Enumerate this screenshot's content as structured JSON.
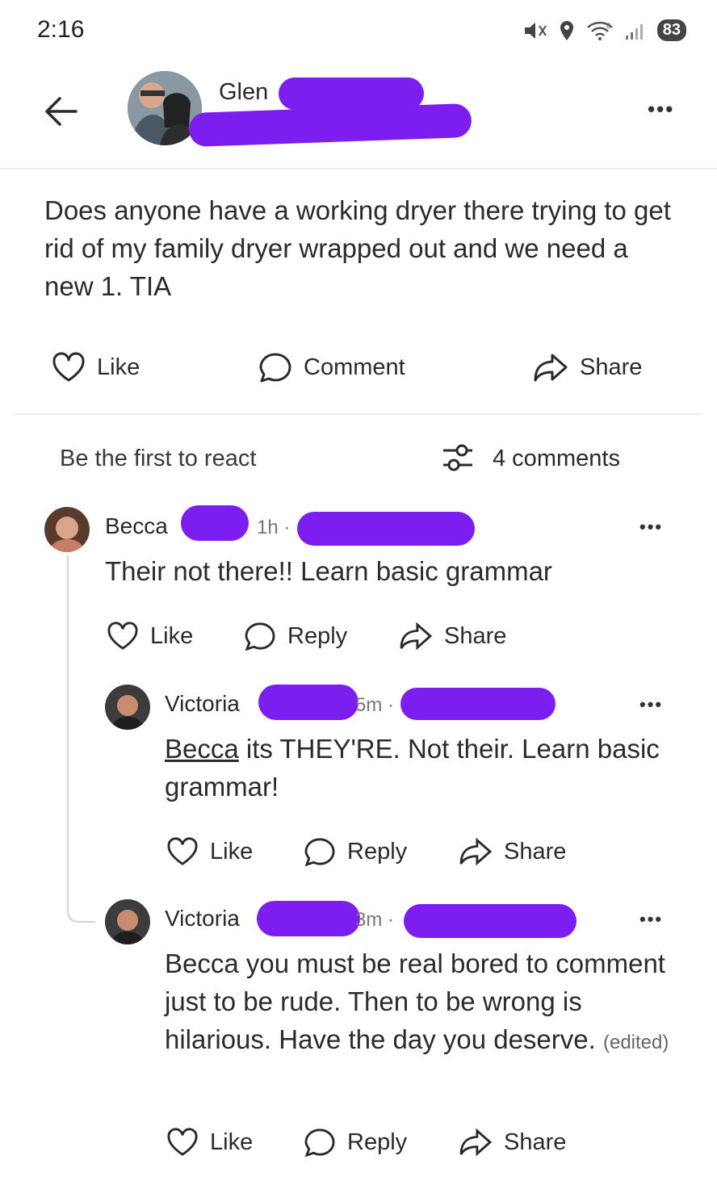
{
  "status_bar": {
    "time": "2:16",
    "battery": "83",
    "network": "6"
  },
  "post": {
    "author_first": "Glen",
    "text": "Does anyone have a working dryer there trying to get rid of my family dryer wrapped out and we need a new 1. TIA",
    "actions": {
      "like": "Like",
      "comment": "Comment",
      "share": "Share"
    },
    "react_prompt": "Be the first to react",
    "comments_count": "4 comments"
  },
  "comments": [
    {
      "name": "Becca",
      "time": "1h ·",
      "text": "Their not there!! Learn basic grammar",
      "actions": {
        "like": "Like",
        "reply": "Reply",
        "share": "Share"
      }
    },
    {
      "name": "Victoria",
      "time": "5m ·",
      "mention": "Becca",
      "text": " its THEY'RE. Not their. Learn basic grammar!",
      "actions": {
        "like": "Like",
        "reply": "Reply",
        "share": "Share"
      }
    },
    {
      "name": "Victoria",
      "time": "3m ·",
      "text": "Becca you must be real bored to comment just to be rude. Then to be wrong is hilarious. Have the day you deserve.",
      "edited": "(edited)",
      "actions": {
        "like": "Like",
        "reply": "Reply",
        "share": "Share"
      }
    }
  ],
  "colors": {
    "redaction": "#7c1ef0"
  }
}
